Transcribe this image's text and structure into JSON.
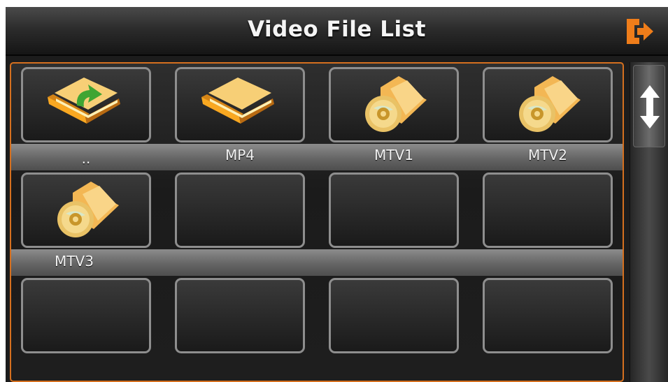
{
  "header": {
    "title": "Video File List",
    "exit_icon": "exit-icon",
    "accent": "#ef7d1a"
  },
  "files": [
    {
      "label": "..",
      "icon": "folder-up-icon"
    },
    {
      "label": "MP4",
      "icon": "folder-icon"
    },
    {
      "label": "MTV1",
      "icon": "video-folder-icon"
    },
    {
      "label": "MTV2",
      "icon": "video-folder-icon"
    },
    {
      "label": "MTV3",
      "icon": "video-folder-icon"
    },
    {
      "label": "",
      "icon": null
    },
    {
      "label": "",
      "icon": null
    },
    {
      "label": "",
      "icon": null
    },
    {
      "label": "",
      "icon": null
    },
    {
      "label": "",
      "icon": null
    },
    {
      "label": "",
      "icon": null
    },
    {
      "label": "",
      "icon": null
    }
  ],
  "scrollbar": {
    "thumb_icon": "up-down-arrow-icon"
  }
}
